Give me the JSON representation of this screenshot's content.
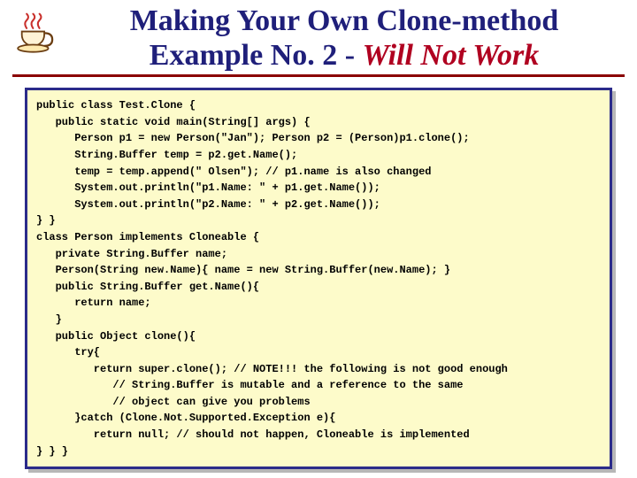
{
  "title": {
    "line1": "Making Your Own Clone-method",
    "line2_prefix": "Example No. 2 - ",
    "line2_emph": "Will Not Work"
  },
  "code": "public class Test.Clone {\n   public static void main(String[] args) {\n      Person p1 = new Person(\"Jan\"); Person p2 = (Person)p1.clone();\n      String.Buffer temp = p2.get.Name();\n      temp = temp.append(\" Olsen\"); // p1.name is also changed\n      System.out.println(\"p1.Name: \" + p1.get.Name());\n      System.out.println(\"p2.Name: \" + p2.get.Name());\n} }\nclass Person implements Cloneable {\n   private String.Buffer name;\n   Person(String new.Name){ name = new String.Buffer(new.Name); }\n   public String.Buffer get.Name(){\n      return name;\n   }\n   public Object clone(){\n      try{\n         return super.clone(); // NOTE!!! the following is not good enough\n            // String.Buffer is mutable and a reference to the same\n            // object can give you problems\n      }catch (Clone.Not.Supported.Exception e){\n         return null; // should not happen, Cloneable is implemented\n} } }"
}
